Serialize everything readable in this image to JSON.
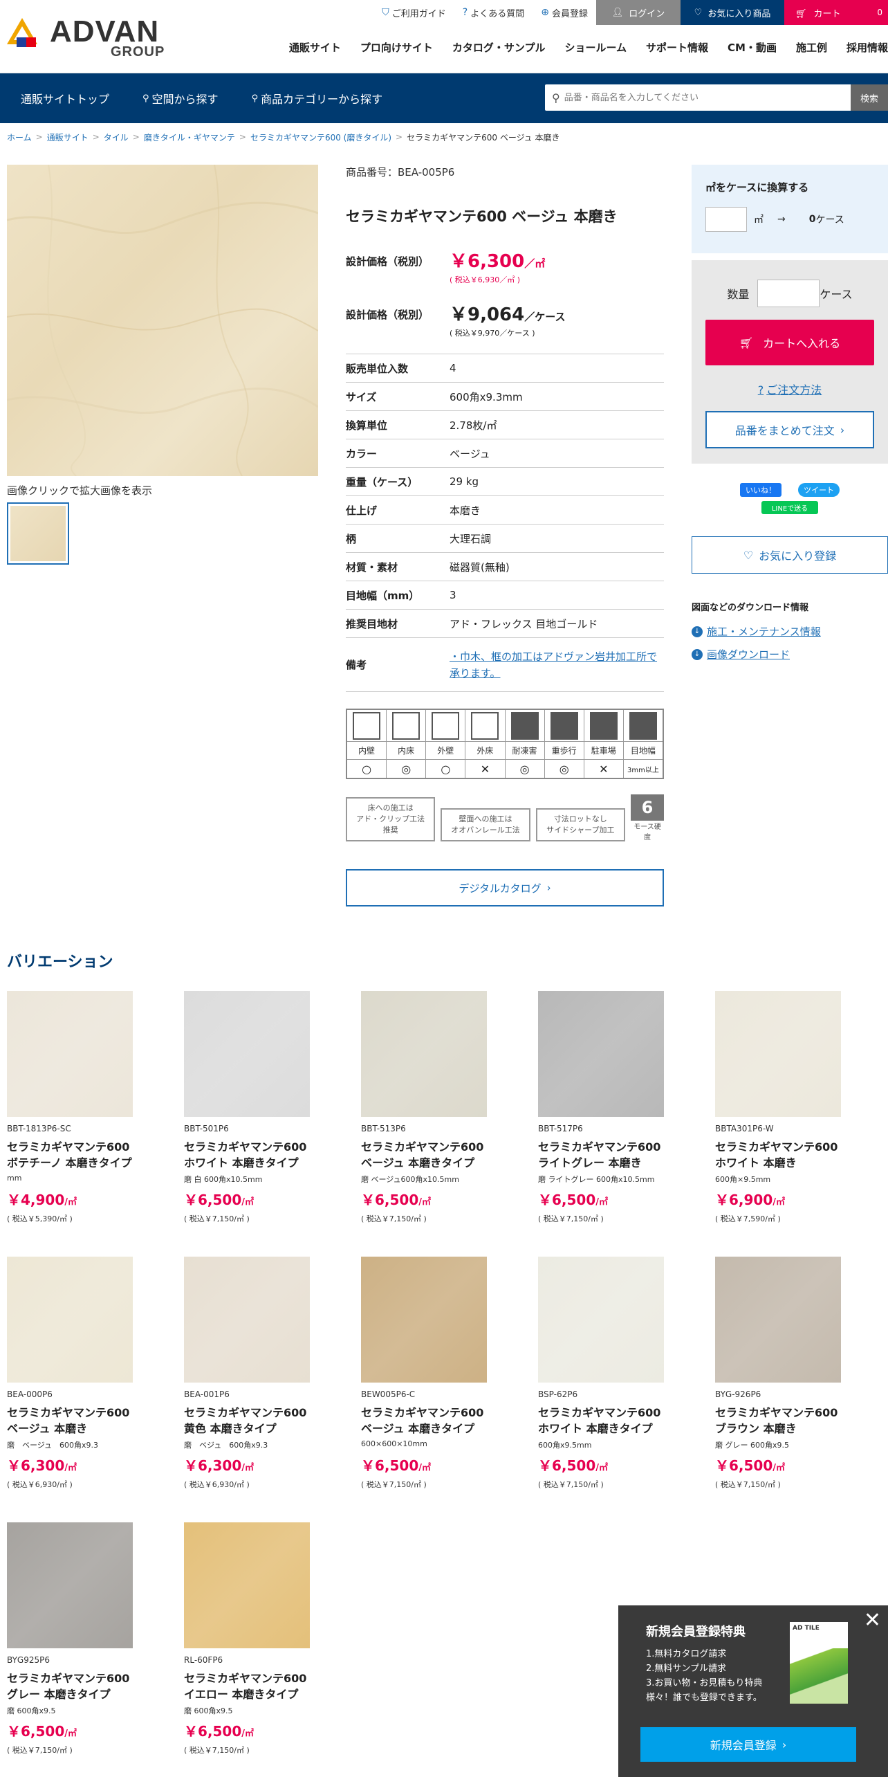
{
  "header": {
    "logo_text": "ADVAN",
    "logo_sub": "GROUP",
    "util": [
      "ご利用ガイド",
      "よくある質問",
      "会員登録"
    ],
    "login": "ログイン",
    "favorites": "お気に入り商品",
    "cart": "カート",
    "cart_count": "0",
    "nav": [
      "通販サイト",
      "プロ向けサイト",
      "カタログ・サンプル",
      "ショールーム",
      "サポート情報",
      "CM・動画",
      "施工例",
      "採用情報"
    ]
  },
  "subnav": {
    "items": [
      "通販サイトトップ",
      "空間から探す",
      "商品カテゴリーから探す"
    ],
    "search_placeholder": "品番・商品名を入力してください",
    "search_button": "検索"
  },
  "breadcrumb": [
    "ホーム",
    "通販サイト",
    "タイル",
    "磨きタイル・ギヤマンテ",
    "セラミカギヤマンテ600 (磨きタイル)",
    "セラミカギヤマンテ600 ベージュ 本磨き"
  ],
  "product": {
    "image_caption": "画像クリックで拡大画像を表示",
    "number": "商品番号：BEA-005P6",
    "name": "セラミカギヤマンテ600 ベージュ 本磨き",
    "price1_label": "設計価格（税別）",
    "price1": "￥6,300",
    "price1_unit": "／㎡",
    "price1_tax": "( 税込￥6,930／㎡ )",
    "price2_label": "設計価格（税別）",
    "price2": "￥9,064",
    "price2_unit": "／ケース",
    "price2_tax": "( 税込￥9,970／ケース )",
    "specs": [
      {
        "k": "販売単位入数",
        "v": "4"
      },
      {
        "k": "サイズ",
        "v": "600角x9.3mm"
      },
      {
        "k": "換算単位",
        "v": "2.78枚/㎡"
      },
      {
        "k": "カラー",
        "v": "ベージュ"
      },
      {
        "k": "重量（ケース）",
        "v": "29 kg"
      },
      {
        "k": "仕上げ",
        "v": "本磨き"
      },
      {
        "k": "柄",
        "v": "大理石調"
      },
      {
        "k": "材質・素材",
        "v": "磁器質(無釉)"
      },
      {
        "k": "目地幅（mm）",
        "v": "3"
      },
      {
        "k": "推奨目地材",
        "v": "アド・フレックス 目地ゴールド"
      },
      {
        "k": "備考",
        "v": "・巾木、框の加工はアドヴァン岩井加工所で承ります。"
      }
    ],
    "usage": [
      {
        "label": "内壁",
        "mark": "○"
      },
      {
        "label": "内床",
        "mark": "◎"
      },
      {
        "label": "外壁",
        "mark": "○"
      },
      {
        "label": "外床",
        "mark": "✕"
      },
      {
        "label": "耐凍害",
        "mark": "◎"
      },
      {
        "label": "重歩行",
        "mark": "◎"
      },
      {
        "label": "駐車場",
        "mark": "✕"
      },
      {
        "label": "目地幅",
        "mark": "3mm以上"
      }
    ],
    "tags": [
      "床への施工は\nアド・クリップ工法推奨",
      "壁面への施工は\nオオバンレール工法",
      "寸法ロットなし\nサイドシャープ加工"
    ],
    "mohs_num": "6",
    "mohs_label": "モース硬度",
    "digital_catalog": "デジタルカタログ"
  },
  "side": {
    "convert_title": "㎡をケースに換算する",
    "convert_unit": "㎡",
    "convert_arrow": "→",
    "convert_result": "0",
    "convert_case": "ケース",
    "qty_label": "数量",
    "qty_unit": "ケース",
    "add_cart": "カートへ入れる",
    "howto": "ご注文方法",
    "bulk": "品番をまとめて注文",
    "fb": "いいね！",
    "tw": "ツイート",
    "line": "LINEで送る",
    "fav": "お気に入り登録",
    "dl_title": "図面などのダウンロード情報",
    "dl_links": [
      "施工・メンテナンス情報",
      "画像ダウンロード"
    ]
  },
  "variation_title": "バリエーション",
  "variations": [
    {
      "code": "BBT-1813P6-SC",
      "name": "セラミカギヤマンテ600\nボテチーノ 本磨きタイプ",
      "spec": "mm",
      "price": "￥4,900",
      "unit": "/㎡",
      "tax": "( 税込￥5,390/㎡ )",
      "color": "#ece6da"
    },
    {
      "code": "BBT-501P6",
      "name": "セラミカギヤマンテ600\nホワイト 本磨きタイプ",
      "spec": "磨 白 600角x10.5mm",
      "price": "￥6,500",
      "unit": "/㎡",
      "tax": "( 税込￥7,150/㎡ )",
      "color": "#dcdcdc"
    },
    {
      "code": "BBT-513P6",
      "name": "セラミカギヤマンテ600\nベージュ 本磨きタイプ",
      "spec": "磨 ベージュ600角x10.5mm",
      "price": "￥6,500",
      "unit": "/㎡",
      "tax": "( 税込￥7,150/㎡ )",
      "color": "#dcd9cc"
    },
    {
      "code": "BBT-517P6",
      "name": "セラミカギヤマンテ600\nライトグレー 本磨き",
      "spec": "磨 ライトグレー 600角x10.5mm",
      "price": "￥6,500",
      "unit": "/㎡",
      "tax": "( 税込￥7,150/㎡ )",
      "color": "#b8b8b8"
    },
    {
      "code": "BBTA301P6-W",
      "name": "セラミカギヤマンテ600\nホワイト 本磨き",
      "spec": "600角×9.5mm",
      "price": "￥6,900",
      "unit": "/㎡",
      "tax": "( 税込￥7,590/㎡ )",
      "color": "#ece8dc"
    },
    {
      "code": "BEA-000P6",
      "name": "セラミカギヤマンテ600\nベージュ 本磨き",
      "spec": "磨　ベージュ　600角x9.3",
      "price": "￥6,300",
      "unit": "/㎡",
      "tax": "( 税込￥6,930/㎡ )",
      "color": "#ede7d5"
    },
    {
      "code": "BEA-001P6",
      "name": "セラミカギヤマンテ600\n黄色 本磨きタイプ",
      "spec": "磨　ベジュ　600角x9.3",
      "price": "￥6,300",
      "unit": "/㎡",
      "tax": "( 税込￥6,930/㎡ )",
      "color": "#e7dfd2"
    },
    {
      "code": "BEW005P6-C",
      "name": "セラミカギヤマンテ600\nベージュ 本磨きタイプ",
      "spec": "600×600×10mm",
      "price": "￥6,500",
      "unit": "/㎡",
      "tax": "( 税込￥7,150/㎡ )",
      "color": "#cdb185"
    },
    {
      "code": "BSP-62P6",
      "name": "セラミカギヤマンテ600\nホワイト 本磨きタイプ",
      "spec": "600角x9.5mm",
      "price": "￥6,500",
      "unit": "/㎡",
      "tax": "( 税込￥7,150/㎡ )",
      "color": "#ecebe2"
    },
    {
      "code": "BYG-926P6",
      "name": "セラミカギヤマンテ600\nブラウン 本磨き",
      "spec": "磨 グレー 600角x9.5",
      "price": "￥6,500",
      "unit": "/㎡",
      "tax": "( 税込￥7,150/㎡ )",
      "color": "#c4baad"
    },
    {
      "code": "BYG925P6",
      "name": "セラミカギヤマンテ600\nグレー 本磨きタイプ",
      "spec": "磨 600角x9.5",
      "price": "￥6,500",
      "unit": "/㎡",
      "tax": "( 税込￥7,150/㎡ )",
      "color": "#a6a39f"
    },
    {
      "code": "RL-60FP6",
      "name": "セラミカギヤマンテ600\nイエロー 本磨きタイプ",
      "spec": "磨 600角x9.5",
      "price": "￥6,500",
      "unit": "/㎡",
      "tax": "( 税込￥7,150/㎡ )",
      "color": "#e4c07a"
    }
  ],
  "popup": {
    "title": "新規会員登録特典",
    "items": [
      "1.無料カタログ請求",
      "2.無料サンプル請求",
      "3.お買い物・お見積もり特典様々！誰でも登録できます。"
    ],
    "book": "AD TILE",
    "button": "新規会員登録",
    "close": "✕"
  }
}
